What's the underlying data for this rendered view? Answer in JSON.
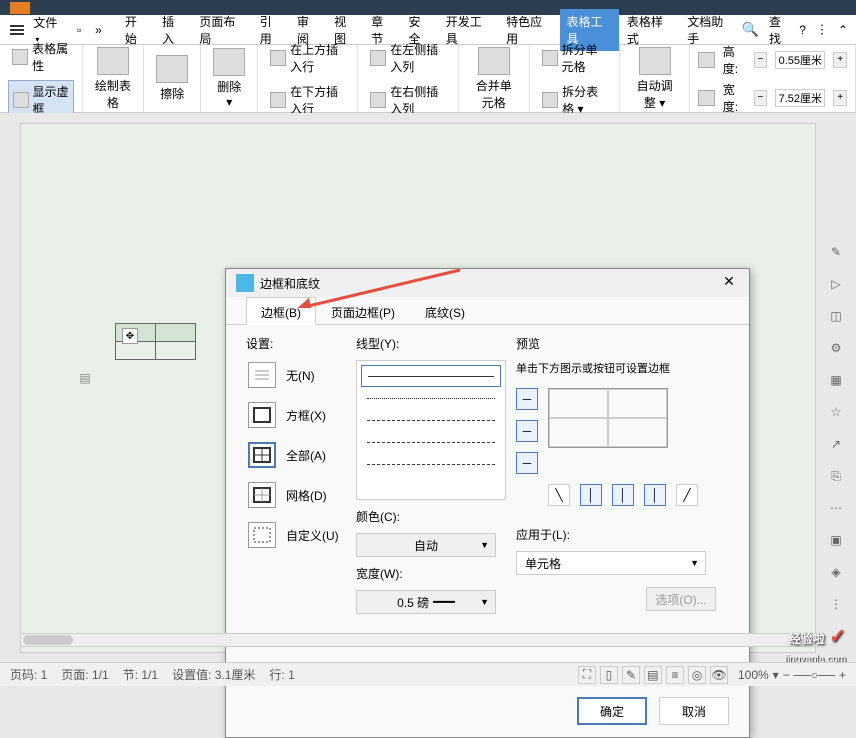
{
  "menubar": {
    "file": "文件",
    "items": [
      "开始",
      "插入",
      "页面布局",
      "引用",
      "审阅",
      "视图",
      "章节",
      "安全",
      "开发工具",
      "特色应用",
      "表格工具",
      "表格样式",
      "文档助手"
    ],
    "active_index": 10,
    "search": "查找"
  },
  "toolbar": {
    "table_props": "表格属性",
    "show_virtual": "显示虚框",
    "draw_table": "绘制表格",
    "erase": "擦除",
    "delete": "删除",
    "insert_above": "在上方插入行",
    "insert_below": "在下方插入行",
    "insert_left": "在左侧插入列",
    "insert_right": "在右侧插入列",
    "merge_cells": "合并单元格",
    "split_cells": "拆分单元格",
    "split_table": "拆分表格",
    "auto_adjust": "自动调整",
    "height_label": "高度:",
    "height_value": "0.55厘米",
    "width_label": "宽度:",
    "width_value": "7.52厘米"
  },
  "dialog": {
    "title": "边框和底纹",
    "tabs": {
      "border": "边框(B)",
      "page_border": "页面边框(P)",
      "shading": "底纹(S)"
    },
    "active_tab": 0,
    "settings": {
      "label": "设置:",
      "none": "无(N)",
      "box": "方框(X)",
      "all": "全部(A)",
      "grid": "网格(D)",
      "custom": "自定义(U)",
      "selected": "all"
    },
    "line_type": {
      "label": "线型(Y):"
    },
    "color": {
      "label": "颜色(C):",
      "value": "自动"
    },
    "width": {
      "label": "宽度(W):",
      "value": "0.5 磅"
    },
    "preview": {
      "label": "预览",
      "hint": "单击下方图示或按钮可设置边框"
    },
    "apply": {
      "label": "应用于(L):",
      "value": "单元格"
    },
    "options_btn": "选项(O)...",
    "ok": "确定",
    "cancel": "取消"
  },
  "statusbar": {
    "page_code": "页码: 1",
    "page": "页面: 1/1",
    "section": "节: 1/1",
    "set_value": "设置值: 3.1厘米",
    "row": "行: 1",
    "zoom": "100%"
  },
  "watermark": {
    "main": "经验啦",
    "sub": "jingyanla.com",
    "check": "✓"
  }
}
